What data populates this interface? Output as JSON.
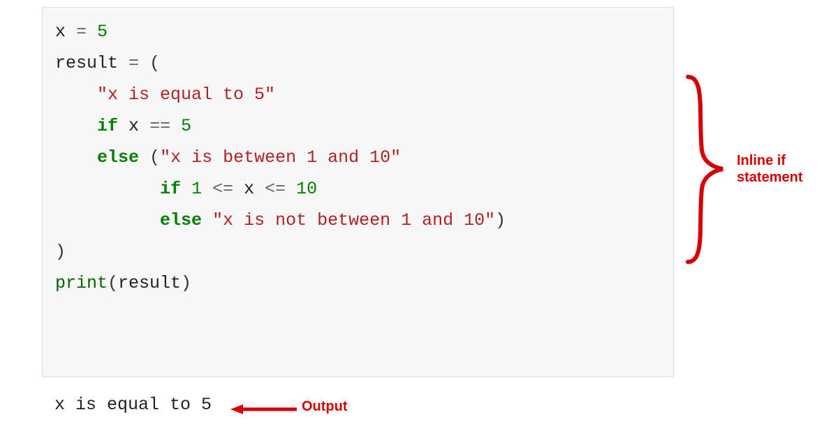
{
  "code": {
    "l1_var": "x",
    "l1_eq": " = ",
    "l1_val": "5",
    "blank": "",
    "l3_var": "result",
    "l3_eq": " = ",
    "l3_paren": "(",
    "l4_indent": "    ",
    "l4_str": "\"x is equal to 5\"",
    "l5_indent": "    ",
    "l5_if": "if",
    "l5_sp": " ",
    "l5_x": "x",
    "l5_eqeq": " == ",
    "l5_five": "5",
    "l6_indent": "    ",
    "l6_else": "else",
    "l6_sp": " ",
    "l6_paren": "(",
    "l6_str": "\"x is between 1 and 10\"",
    "l7_indent": "          ",
    "l7_if": "if",
    "l7_sp1": " ",
    "l7_one": "1",
    "l7_le1": " <= ",
    "l7_x": "x",
    "l7_le2": " <= ",
    "l7_ten": "10",
    "l8_indent": "          ",
    "l8_else": "else",
    "l8_sp": " ",
    "l8_str": "\"x is not between 1 and 10\"",
    "l8_cp": ")",
    "l9_cp": ")",
    "l11_print": "print",
    "l11_op": "(",
    "l11_arg": "result",
    "l11_cp": ")"
  },
  "output_text": "x is equal to 5",
  "labels": {
    "inline_if": "Inline if statement",
    "output": "Output"
  },
  "colors": {
    "annotation": "#d60000"
  }
}
